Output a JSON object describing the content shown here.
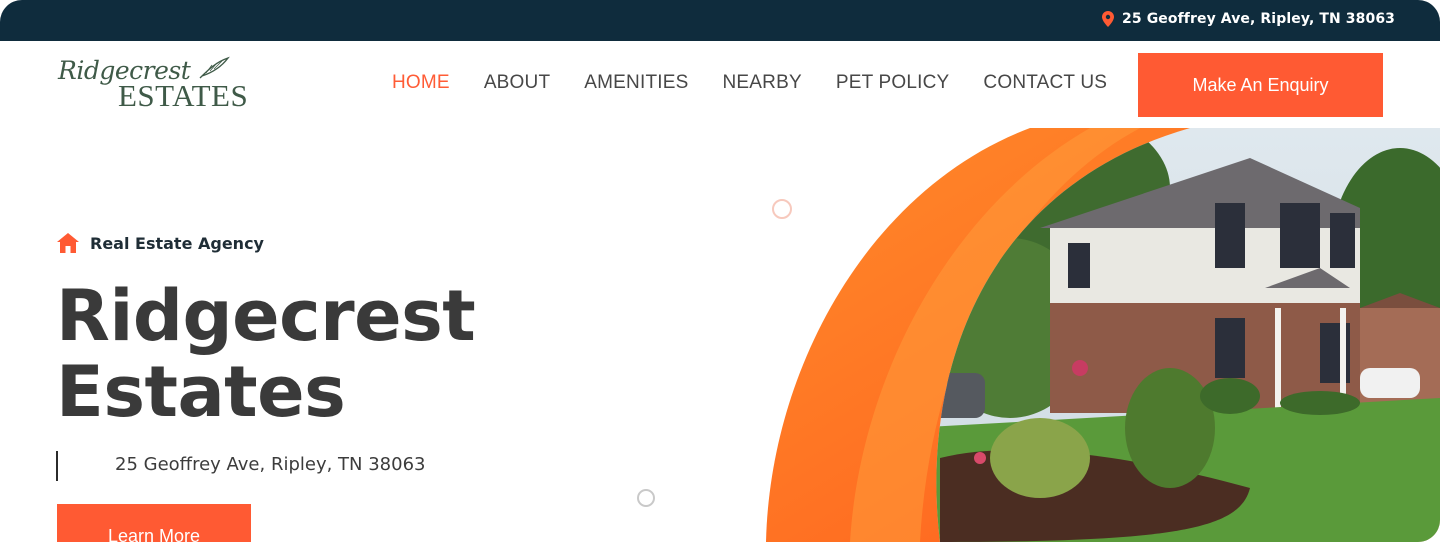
{
  "topbar": {
    "address": "25 Geoffrey Ave, Ripley, TN 38063",
    "icon": "location-pin-icon"
  },
  "logo": {
    "script_text": "Ridgecrest",
    "caps_text": "ESTATES"
  },
  "nav": {
    "items": [
      {
        "label": "HOME",
        "active": true
      },
      {
        "label": "ABOUT",
        "active": false
      },
      {
        "label": "AMENITIES",
        "active": false
      },
      {
        "label": "NEARBY",
        "active": false
      },
      {
        "label": "PET POLICY",
        "active": false
      },
      {
        "label": "CONTACT US",
        "active": false
      }
    ],
    "cta_label": "Make An Enquiry"
  },
  "hero": {
    "tag_label": "Real Estate Agency",
    "title_line1": "Ridgecrest",
    "title_line2": "Estates",
    "address": "25 Geoffrey Ave, Ripley, TN 38063",
    "button_label": "Learn More"
  },
  "colors": {
    "accent": "#ff5a33",
    "topbar": "#0f2c3d",
    "heading": "#3a3a3a"
  }
}
